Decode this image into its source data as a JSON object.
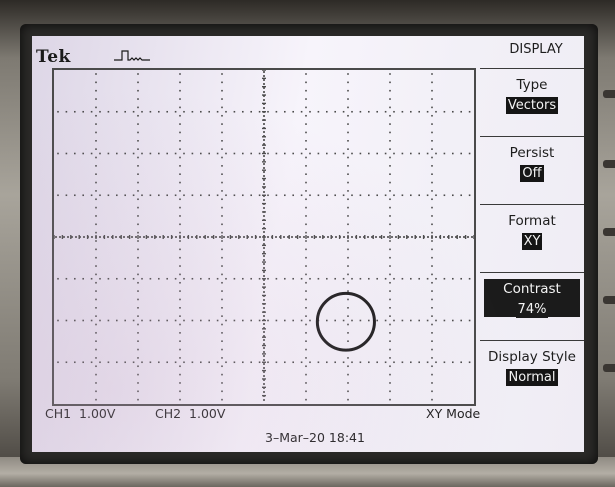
{
  "header": {
    "brand": "Tek"
  },
  "footer": {
    "ch1_label": "CH1",
    "ch1_scale": "1.00V",
    "ch2_label": "CH2",
    "ch2_scale": "1.00V",
    "mode": "XY Mode",
    "timestamp": "3–Mar–20 18:41"
  },
  "menu": {
    "title": "DISPLAY",
    "items": [
      {
        "label": "Type",
        "value": "Vectors",
        "selected": false
      },
      {
        "label": "Persist",
        "value": "Off",
        "selected": false
      },
      {
        "label": "Format",
        "value": "XY",
        "selected": false
      },
      {
        "label": "Contrast",
        "value": "74%",
        "selected": true
      },
      {
        "label": "Display Style",
        "value": "Normal",
        "selected": false
      }
    ]
  },
  "colors": {
    "screen_background": "#f4f1f8",
    "trace": "#1a1a1a",
    "highlight": "#1b1b1b"
  },
  "icons": {
    "trigger": "trigger-pulse-icon"
  }
}
